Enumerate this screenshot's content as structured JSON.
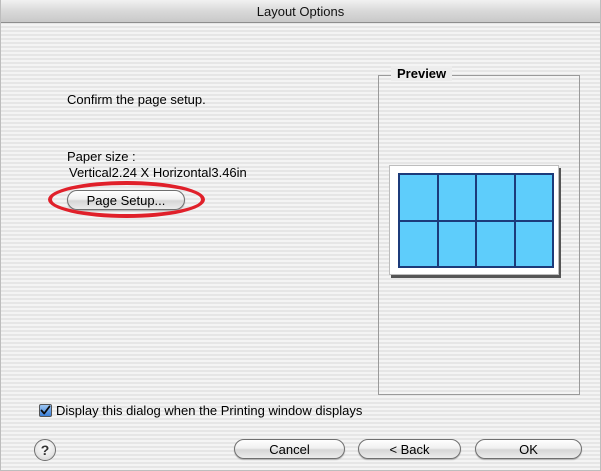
{
  "window": {
    "title": "Layout Options"
  },
  "main": {
    "instruction": "Confirm the page setup.",
    "paper_size_label": "Paper size :",
    "paper_size_value": "Vertical2.24 X Horizontal3.46in",
    "page_setup_button": "Page Setup..."
  },
  "preview": {
    "legend": "Preview",
    "rows": 2,
    "columns": 4,
    "cell_color": "#5ecdfb"
  },
  "footer": {
    "checkbox_label": "Display this dialog when the Printing window displays",
    "checkbox_checked": true,
    "help_label": "?",
    "cancel_label": "Cancel",
    "back_label": "< Back",
    "ok_label": "OK"
  },
  "colors": {
    "highlight": "#e0202a",
    "accent": "#3b7fd8"
  }
}
